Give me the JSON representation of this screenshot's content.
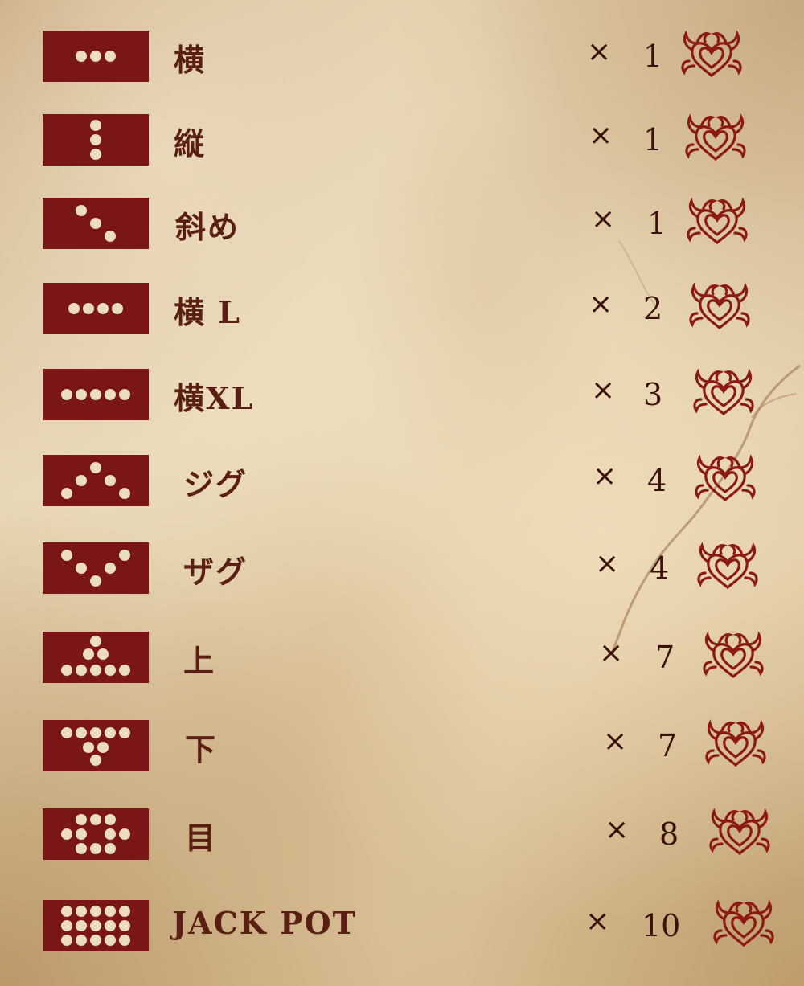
{
  "paytable": {
    "rows": [
      {
        "name": "横",
        "mult": "1",
        "pattern": "h3"
      },
      {
        "name": "縦",
        "mult": "1",
        "pattern": "v3"
      },
      {
        "name": "斜め",
        "mult": "1",
        "pattern": "d3"
      },
      {
        "name": "横 L",
        "mult": "2",
        "pattern": "h4"
      },
      {
        "name": "横XL",
        "mult": "3",
        "pattern": "h5"
      },
      {
        "name": "ジグ",
        "mult": "4",
        "pattern": "zig"
      },
      {
        "name": "ザグ",
        "mult": "4",
        "pattern": "zag"
      },
      {
        "name": "上",
        "mult": "7",
        "pattern": "up"
      },
      {
        "name": "下",
        "mult": "7",
        "pattern": "down"
      },
      {
        "name": "目",
        "mult": "8",
        "pattern": "eye"
      },
      {
        "name": "JACK POT",
        "mult": "10",
        "pattern": "all"
      }
    ],
    "times_sign": "×"
  },
  "colors": {
    "tile_bg": "#7a1616",
    "dot": "#ecdcc0",
    "text": "#5a1f12",
    "emblem": "#8a1a12"
  },
  "icons": {
    "emblem": "tribal-heart-icon"
  }
}
